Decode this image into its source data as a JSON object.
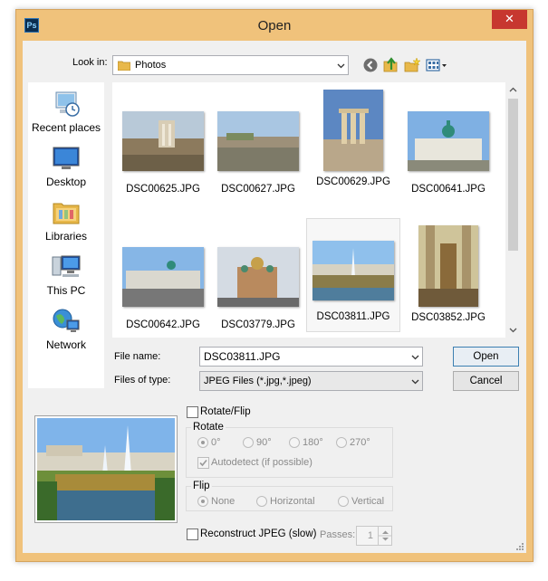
{
  "window": {
    "title": "Open",
    "app_icon_text": "Ps",
    "close_glyph": "✕"
  },
  "look_in": {
    "label": "Look in:",
    "value": "Photos",
    "toolbar_icons": [
      "back-icon",
      "up-folder-icon",
      "new-folder-icon",
      "view-menu-icon"
    ]
  },
  "places": [
    {
      "label": "Recent places",
      "icon": "recent-places-icon"
    },
    {
      "label": "Desktop",
      "icon": "desktop-icon"
    },
    {
      "label": "Libraries",
      "icon": "libraries-icon"
    },
    {
      "label": "This PC",
      "icon": "this-pc-icon"
    },
    {
      "label": "Network",
      "icon": "network-icon"
    }
  ],
  "files": [
    {
      "name": "DSC00625.JPG",
      "selected": false
    },
    {
      "name": "DSC00627.JPG",
      "selected": false
    },
    {
      "name": "DSC00629.JPG",
      "selected": false
    },
    {
      "name": "DSC00641.JPG",
      "selected": false
    },
    {
      "name": "DSC00642.JPG",
      "selected": false
    },
    {
      "name": "DSC03779.JPG",
      "selected": false
    },
    {
      "name": "DSC03811.JPG",
      "selected": true
    },
    {
      "name": "DSC03852.JPG",
      "selected": false
    }
  ],
  "file_name": {
    "label": "File name:",
    "value": "DSC03811.JPG"
  },
  "file_type": {
    "label": "Files of type:",
    "value": "JPEG Files (*.jpg,*.jpeg)"
  },
  "buttons": {
    "open": "Open",
    "cancel": "Cancel"
  },
  "options": {
    "rotate_flip_label": "Rotate/Flip",
    "rotate_group": "Rotate",
    "rotate_options": [
      "0°",
      "90°",
      "180°",
      "270°"
    ],
    "rotate_selected": "0°",
    "autodetect_label": "Autodetect (if possible)",
    "autodetect_checked": true,
    "flip_group": "Flip",
    "flip_options": [
      "None",
      "Horizontal",
      "Vertical"
    ],
    "flip_selected": "None",
    "reconstruct_label": "Reconstruct JPEG (slow)",
    "passes_label": "Passes:",
    "passes_value": "1"
  },
  "colors": {
    "window_border": "#f0c27b",
    "close_button": "#c7372f",
    "dialog_bg": "#f0f0f0",
    "default_button_border": "#3c7fb1"
  }
}
